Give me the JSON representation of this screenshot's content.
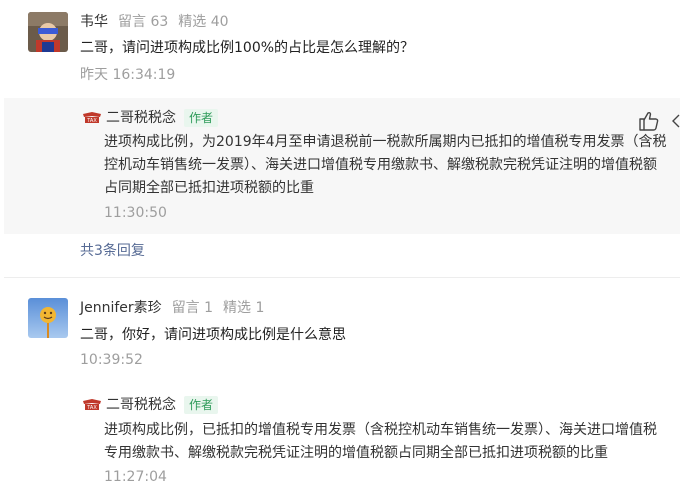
{
  "comments": [
    {
      "author": "韦华",
      "messages_label": "留言 63",
      "featured_label": "精选 40",
      "text": "二哥，请问进项构成比例100%的占比是怎么理解的？",
      "time": "昨天 16:34:19",
      "reply": {
        "author": "二哥税税念",
        "tag": "作者",
        "text": "进项构成比例，为2019年4月至申请退税前一税款所属期内已抵扣的增值税专用发票（含税控机动车销售统一发票）、海关进口增值税专用缴款书、解缴税款完税凭证注明的增值税额占同期全部已抵扣进项税额的比重",
        "time": "11:30:50"
      },
      "more_replies": "共3条回复"
    },
    {
      "author": "Jennifer素珍",
      "messages_label": "留言 1",
      "featured_label": "精选 1",
      "text": "二哥，你好，请问进项构成比例是什么意思",
      "time": "10:39:52",
      "reply": {
        "author": "二哥税税念",
        "tag": "作者",
        "text": "进项构成比例，已抵扣的增值税专用发票（含税控机动车销售统一发票）、海关进口增值税专用缴款书、解缴税款完税凭证注明的增值税额占同期全部已抵扣进项税额的比重",
        "time": "11:27:04"
      }
    }
  ],
  "icons": {
    "like": "thumbs-up-icon",
    "logo": "tax-logo-icon"
  }
}
